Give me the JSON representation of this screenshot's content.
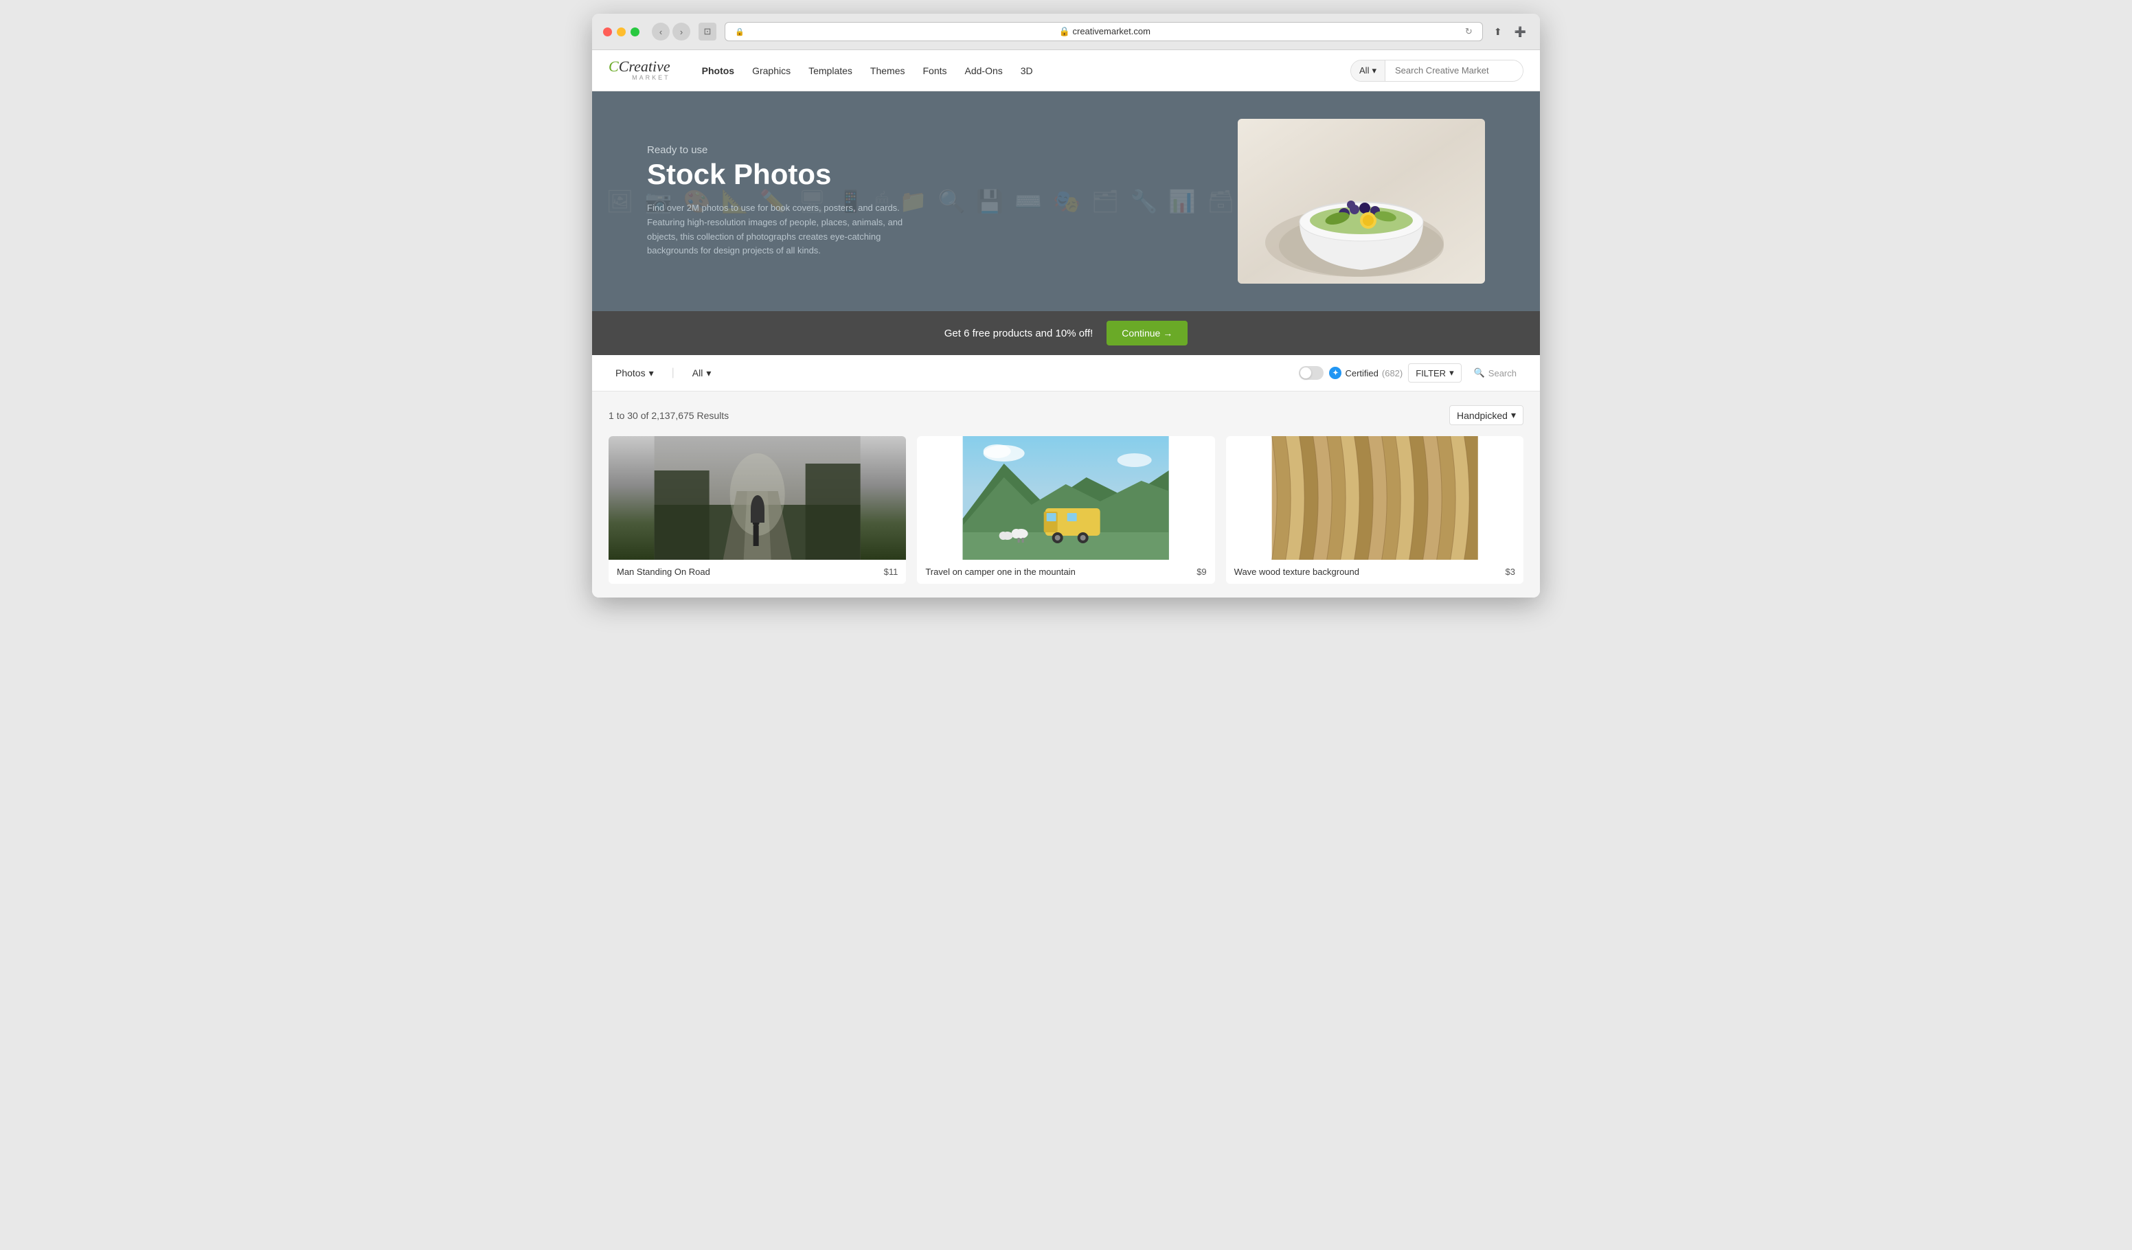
{
  "browser": {
    "url": "creativemarket.com",
    "url_display": "🔒 creativemarket.com",
    "refresh_icon": "↻"
  },
  "site": {
    "logo": {
      "creative": "Creative",
      "market": "MARKET"
    },
    "nav": {
      "items": [
        {
          "id": "photos",
          "label": "Photos",
          "active": true
        },
        {
          "id": "graphics",
          "label": "Graphics"
        },
        {
          "id": "templates",
          "label": "Templates"
        },
        {
          "id": "themes",
          "label": "Themes"
        },
        {
          "id": "fonts",
          "label": "Fonts"
        },
        {
          "id": "addons",
          "label": "Add-Ons"
        },
        {
          "id": "3d",
          "label": "3D"
        }
      ]
    },
    "search": {
      "category": "All",
      "placeholder": "Search Creative Market",
      "chevron": "▾"
    }
  },
  "hero": {
    "pretitle": "Ready to use",
    "title": "Stock Photos",
    "description": "Find over 2M photos to use for book covers, posters, and cards. Featuring high-resolution images of people, places, animals, and objects, this collection of photographs creates eye-catching backgrounds for design projects of all kinds."
  },
  "promo": {
    "text": "Get 6 free products and 10% off!",
    "button_label": "Continue →"
  },
  "filter": {
    "category": "Photos",
    "subcategory": "All",
    "chevron": "▾",
    "certified_label": "Certified",
    "certified_count": "(682)",
    "filter_label": "FILTER",
    "search_label": "Search"
  },
  "results": {
    "range_start": "1",
    "range_end": "30",
    "total": "2,137,675",
    "label": "Results",
    "sort_label": "Handpicked",
    "chevron": "▾"
  },
  "products": [
    {
      "id": "product-1",
      "title": "Man Standing On Road",
      "price": "$11",
      "img_type": "forest"
    },
    {
      "id": "product-2",
      "title": "Travel on camper one in the mountain",
      "price": "$9",
      "img_type": "camper"
    },
    {
      "id": "product-3",
      "title": "Wave wood texture background",
      "price": "$3",
      "img_type": "wood"
    }
  ]
}
